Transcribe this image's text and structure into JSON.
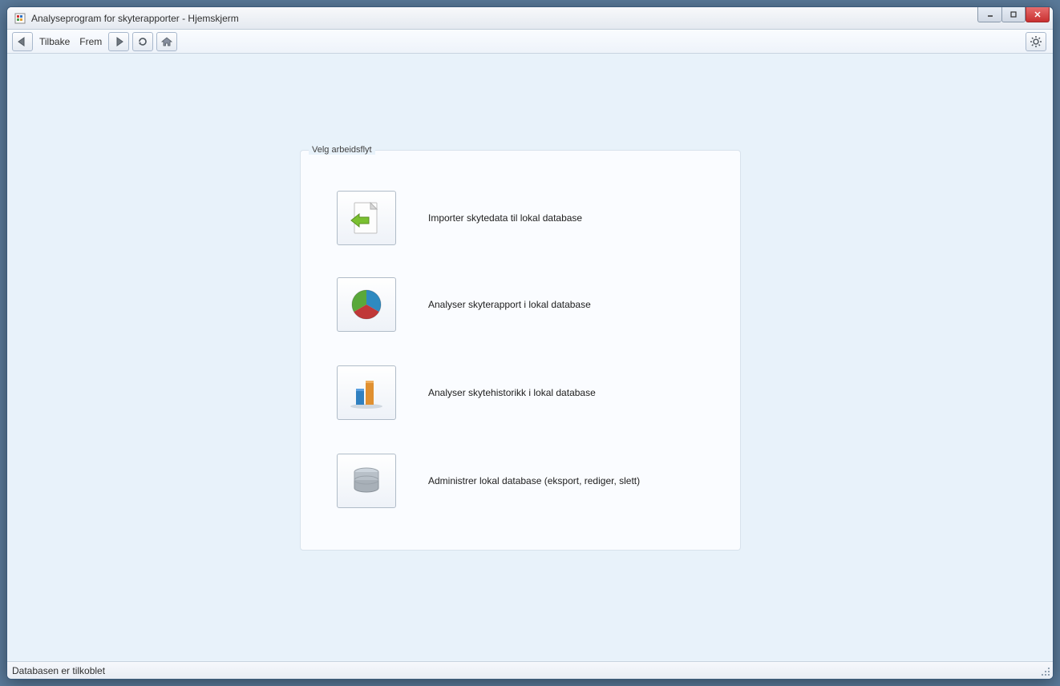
{
  "window": {
    "title": "Analyseprogram for skyterapporter - Hjemskjerm"
  },
  "toolbar": {
    "back_label": "Tilbake",
    "forward_label": "Frem"
  },
  "panel": {
    "title": "Velg arbeidsflyt",
    "items": [
      {
        "label": "Importer skytedata til lokal database"
      },
      {
        "label": "Analyser skyterapport i lokal database"
      },
      {
        "label": "Analyser skytehistorikk i lokal database"
      },
      {
        "label": "Administrer lokal database (eksport, rediger, slett)"
      }
    ]
  },
  "status": {
    "text": "Databasen er tilkoblet"
  }
}
